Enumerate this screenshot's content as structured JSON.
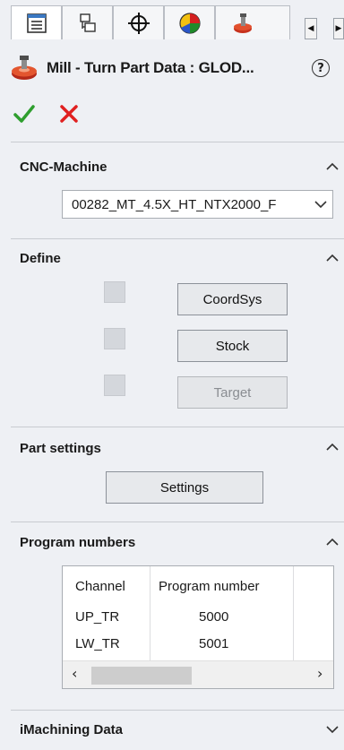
{
  "title": "Mill - Turn Part Data : GLOD...",
  "sections": {
    "cnc_machine": {
      "title": "CNC-Machine",
      "machine_value": "00282_MT_4.5X_HT_NTX2000_F"
    },
    "define": {
      "title": "Define",
      "coordsys_label": "CoordSys",
      "stock_label": "Stock",
      "target_label": "Target"
    },
    "part_settings": {
      "title": "Part settings",
      "settings_label": "Settings"
    },
    "program_numbers": {
      "title": "Program numbers",
      "columns": [
        "Channel",
        "Program number"
      ],
      "rows": [
        {
          "channel": "UP_TR",
          "number": "5000"
        },
        {
          "channel": "LW_TR",
          "number": "5001"
        }
      ]
    },
    "imachining": {
      "title": "iMachining Data"
    }
  },
  "icons": {
    "tabs": [
      "feature-manager-icon",
      "property-manager-icon",
      "configuration-manager-icon",
      "display-manager-icon",
      "camworks-icon"
    ],
    "accept": "checkmark-icon",
    "cancel": "x-icon",
    "help": "help-icon"
  },
  "colors": {
    "accept": "#2e9e2e",
    "cancel": "#e02020",
    "background": "#eef0f4"
  }
}
